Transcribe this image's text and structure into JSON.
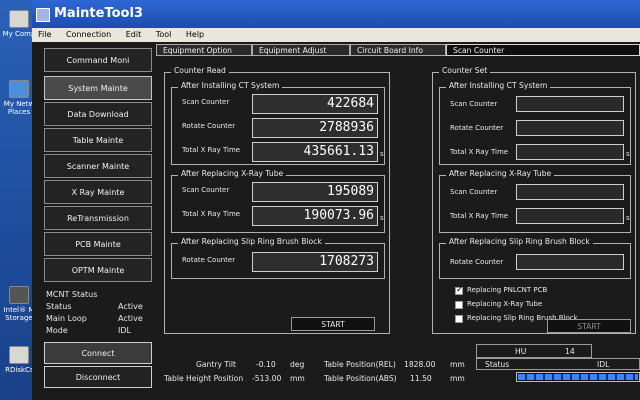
{
  "desktop": {
    "icons": [
      {
        "label": "My Comp",
        "icon": "computer-icon"
      },
      {
        "label": "My Netw\nPlaces",
        "icon": "network-icon"
      },
      {
        "label": "Intel® M\nStorage",
        "icon": "storage-icon"
      },
      {
        "label": "RDiskCr",
        "icon": "disk-icon"
      }
    ]
  },
  "window": {
    "title": "MainteTool3",
    "menu": [
      "File",
      "Connection",
      "Edit",
      "Tool",
      "Help"
    ]
  },
  "nav": {
    "items": [
      "Command Moni",
      "System Mainte",
      "Data Download",
      "Table Mainte",
      "Scanner Mainte",
      "X Ray Mainte",
      "ReTransmission",
      "PCB Mainte",
      "OPTM Mainte"
    ],
    "active_index": 1
  },
  "mcnt_status": {
    "title": "MCNT Status",
    "rows": [
      {
        "label": "Status",
        "value": "Active"
      },
      {
        "label": "Main Loop",
        "value": "Active"
      },
      {
        "label": "Mode",
        "value": "IDL"
      }
    ]
  },
  "connection": {
    "connect_label": "Connect",
    "disconnect_label": "Disconnect"
  },
  "tabs": [
    {
      "label": "Equipment Option"
    },
    {
      "label": "Equipment Adjust"
    },
    {
      "label": "Circuit Board Info"
    },
    {
      "label": "Scan Counter"
    }
  ],
  "counter_read": {
    "title": "Counter Read",
    "ct_system": {
      "title": "After Installing CT System",
      "scan_counter_label": "Scan Counter",
      "scan_counter_value": "422684",
      "rotate_counter_label": "Rotate Counter",
      "rotate_counter_value": "2788936",
      "total_xray_label": "Total X Ray Time",
      "total_xray_value": "435661.13",
      "total_xray_unit": "s"
    },
    "xray_tube": {
      "title": "After Replacing X-Ray Tube",
      "scan_counter_label": "Scan Counter",
      "scan_counter_value": "195089",
      "total_xray_label": "Total X Ray Time",
      "total_xray_value": "190073.96",
      "total_xray_unit": "s"
    },
    "slip_ring": {
      "title": "After Replacing Slip Ring Brush Block",
      "rotate_counter_label": "Rotate Counter",
      "rotate_counter_value": "1708273"
    },
    "start_label": "START"
  },
  "counter_set": {
    "title": "Counter Set",
    "ct_system": {
      "title": "After Installing CT System",
      "scan_counter_label": "Scan Counter",
      "rotate_counter_label": "Rotate Counter",
      "total_xray_label": "Total X Ray Time",
      "total_xray_unit": "s",
      "scan_counter_value": "",
      "rotate_counter_value": "",
      "total_xray_value": ""
    },
    "xray_tube": {
      "title": "After Replacing X-Ray Tube",
      "scan_counter_label": "Scan Counter",
      "total_xray_label": "Total X Ray Time",
      "total_xray_unit": "s",
      "scan_counter_value": "",
      "total_xray_value": ""
    },
    "slip_ring": {
      "title": "After Replacing Slip Ring Brush Block",
      "rotate_counter_label": "Rotate Counter",
      "rotate_counter_value": ""
    },
    "checks": [
      {
        "label": "Replacing PNLCNT PCB",
        "checked": true
      },
      {
        "label": "Replacing X-Ray Tube",
        "checked": false
      },
      {
        "label": "Replacing Slip Ring Brush Block",
        "checked": false
      }
    ],
    "start_label": "START"
  },
  "bottom": {
    "gantry_tilt_label": "Gantry Tilt",
    "gantry_tilt_value": "-0.10",
    "gantry_tilt_unit": "deg",
    "table_height_label": "Table Height Position",
    "table_height_value": "-513.00",
    "table_height_unit": "mm",
    "table_rel_label": "Table Position(REL)",
    "table_rel_value": "1828.00",
    "table_rel_unit": "mm",
    "table_abs_label": "Table Position(ABS)",
    "table_abs_value": "11.50",
    "table_abs_unit": "mm",
    "hu_label": "HU",
    "hu_value": "14",
    "status_label": "Status",
    "status_value": "IDL",
    "progress_fraction": 1.0
  },
  "colors": {
    "desktop_bg": "#1f4f9e",
    "titlebar": "#1d4cb0",
    "window_bg": "#1b1b1b",
    "progress": "#3a86ff"
  }
}
